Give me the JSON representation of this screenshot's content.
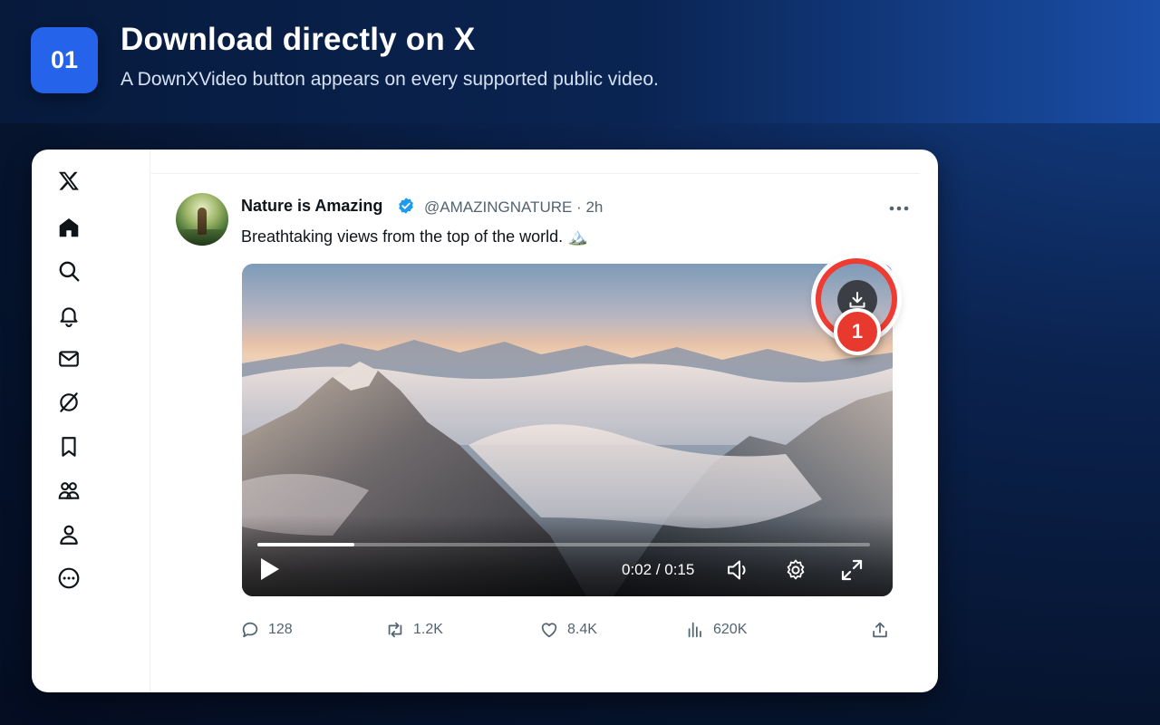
{
  "banner": {
    "step_number": "01",
    "title": "Download directly on X",
    "subtitle": "A DownXVideo button appears on every supported public video."
  },
  "sidebar": {
    "items": [
      {
        "icon": "x-logo-icon"
      },
      {
        "icon": "home-icon"
      },
      {
        "icon": "search-icon"
      },
      {
        "icon": "bell-icon"
      },
      {
        "icon": "mail-icon"
      },
      {
        "icon": "grok-icon"
      },
      {
        "icon": "bookmark-icon"
      },
      {
        "icon": "communities-icon"
      },
      {
        "icon": "profile-icon"
      },
      {
        "icon": "more-circle-icon"
      }
    ]
  },
  "tweet": {
    "author_name": "Nature is Amazing",
    "handle_time": "@AMAZINGNATURE · 2h",
    "text": "Breathtaking views from the top of the world. 🏔️",
    "video": {
      "time": "0:02 / 0:15",
      "progress": 0.158
    },
    "download_step_marker": "1",
    "actions": {
      "replies": "128",
      "reposts": "1.2K",
      "likes": "8.4K",
      "views": "620K"
    }
  },
  "colors": {
    "accent_blue": "#2563eb",
    "verified_blue": "#1d9bf0",
    "highlight_red": "#ef3b32"
  }
}
